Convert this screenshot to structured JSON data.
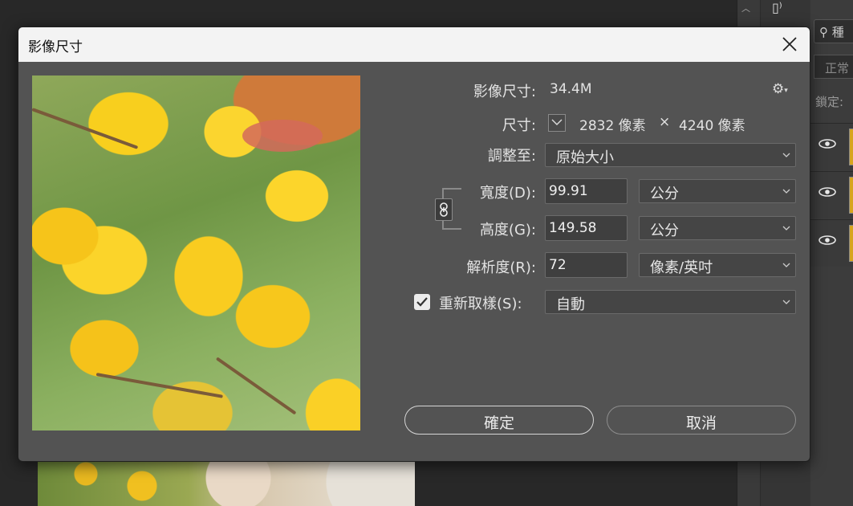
{
  "background": {
    "search_text": "種",
    "blend_mode": "正常",
    "lock_label": "鎖定:"
  },
  "dialog": {
    "title": "影像尺寸",
    "image_size_label": "影像尺寸:",
    "image_size_value": "34.4M",
    "dimensions_label": "尺寸:",
    "dim_width": "2832 像素",
    "dim_separator": "×",
    "dim_height": "4240 像素",
    "fit_to_label": "調整至:",
    "fit_to_value": "原始大小",
    "width_label": "寬度(D):",
    "width_value": "99.91",
    "width_unit": "公分",
    "height_label": "高度(G):",
    "height_value": "149.58",
    "height_unit": "公分",
    "resolution_label": "解析度(R):",
    "resolution_value": "72",
    "resolution_unit": "像素/英吋",
    "resample_label": "重新取樣(S):",
    "resample_checked": true,
    "resample_value": "自動",
    "ok_label": "確定",
    "cancel_label": "取消"
  },
  "icons": [
    "close-icon",
    "gear-icon",
    "chevron-down-icon",
    "link-icon",
    "checkmark-icon",
    "eye-icon",
    "search-icon"
  ]
}
